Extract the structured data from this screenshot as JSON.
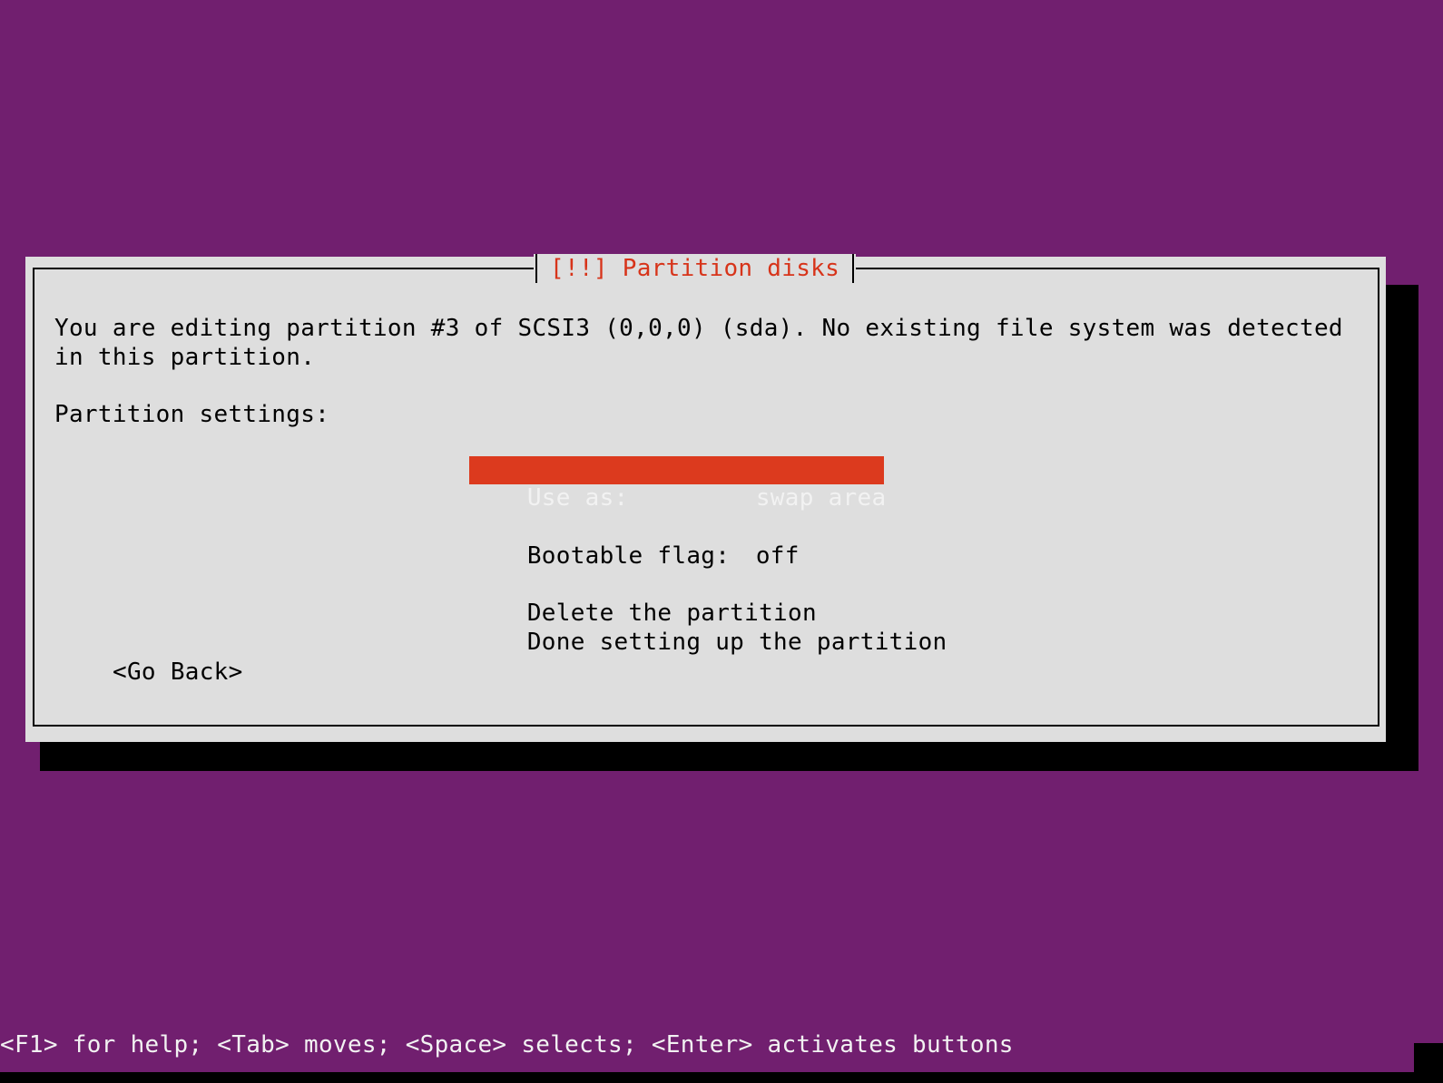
{
  "dialog": {
    "title": "[!!] Partition disks",
    "description_lines": [
      "You are editing partition #3 of SCSI3 (0,0,0) (sda). No existing file system was detected",
      "in this partition."
    ],
    "section_label": "Partition settings:",
    "menu": [
      {
        "label": "Use as:",
        "value": "swap area",
        "selected": true
      },
      {
        "label": "Bootable flag:",
        "value": "off",
        "selected": false
      },
      {
        "label": "Delete the partition",
        "value": "",
        "selected": false
      },
      {
        "label": "Done setting up the partition",
        "value": "",
        "selected": false
      }
    ],
    "go_back_label": "<Go Back>"
  },
  "help_bar": "<F1> for help; <Tab> moves; <Space> selects; <Enter> activates buttons",
  "colors": {
    "background": "#711f6f",
    "dialog": "#dedede",
    "title": "#d7341a",
    "selection": "#dc3a1e"
  }
}
